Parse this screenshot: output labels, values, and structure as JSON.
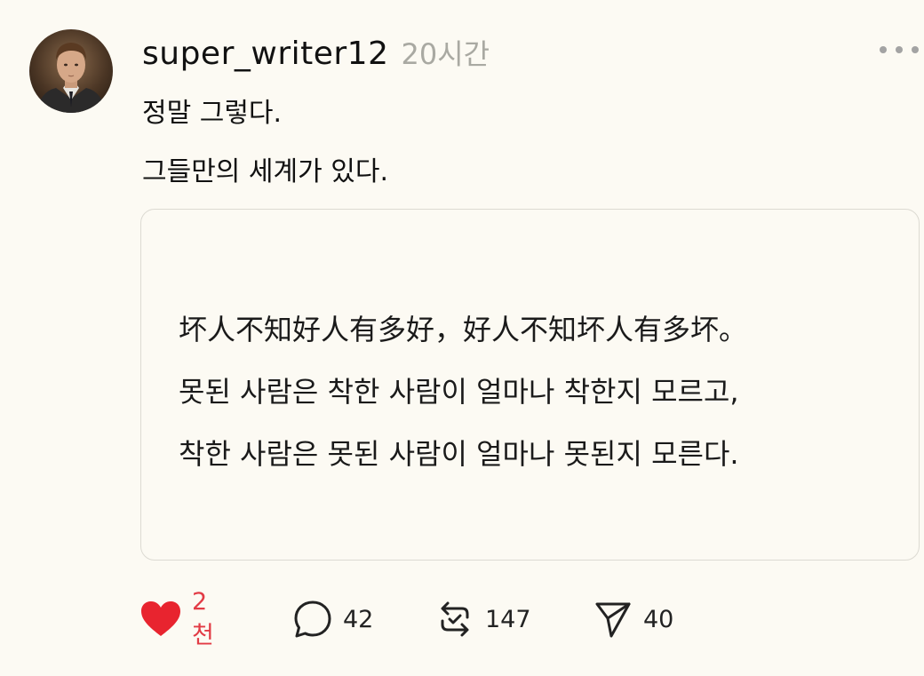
{
  "post": {
    "username": "super_writer12",
    "timestamp": "20시간",
    "text_lines": [
      "정말 그렇다.",
      "그들만의 세계가 있다."
    ],
    "quote": {
      "lines": [
        "坏人不知好人有多好，好人不知坏人有多坏。",
        "못된 사람은 착한 사람이 얼마나 착한지 모르고,",
        "착한 사람은 못된 사람이 얼마나 못된지 모른다."
      ]
    },
    "actions": {
      "likes": "2천",
      "comments": "42",
      "reposts": "147",
      "shares": "40"
    },
    "icons": {
      "avatar": "avatar-portrait",
      "more": "more-dots-icon",
      "like": "heart-icon",
      "comment": "comment-bubble-icon",
      "repost": "repost-icon",
      "share": "send-icon"
    },
    "colors": {
      "background": "#fcfaf3",
      "like_active": "#e23b45",
      "timestamp": "#a9a9a2",
      "border": "#dcdad2"
    }
  }
}
